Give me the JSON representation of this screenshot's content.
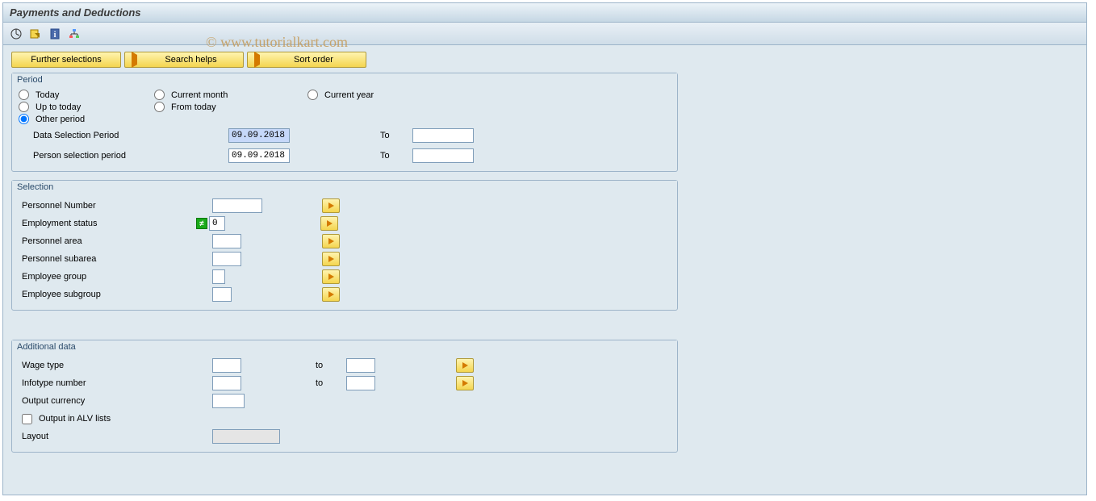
{
  "title": "Payments and Deductions",
  "watermark": "© www.tutorialkart.com",
  "toolbar_icons": [
    "execute-icon",
    "variant-icon",
    "info-icon",
    "layout-icon"
  ],
  "action_buttons": {
    "further_selections": "Further selections",
    "search_helps": "Search helps",
    "sort_order": "Sort order"
  },
  "period": {
    "group_title": "Period",
    "options": {
      "today": "Today",
      "current_month": "Current month",
      "current_year": "Current year",
      "up_to_today": "Up to today",
      "from_today": "From today",
      "other_period": "Other period"
    },
    "selected": "other_period",
    "data_selection_label": "Data Selection Period",
    "data_selection_from": "09.09.2018",
    "data_selection_to_label": "To",
    "data_selection_to": "",
    "person_selection_label": "Person selection period",
    "person_selection_from": "09.09.2018",
    "person_selection_to_label": "To",
    "person_selection_to": ""
  },
  "selection": {
    "group_title": "Selection",
    "personnel_number": {
      "label": "Personnel Number",
      "value": ""
    },
    "employment_status": {
      "label": "Employment status",
      "value": "0"
    },
    "personnel_area": {
      "label": "Personnel area",
      "value": ""
    },
    "personnel_subarea": {
      "label": "Personnel subarea",
      "value": ""
    },
    "employee_group": {
      "label": "Employee group",
      "value": ""
    },
    "employee_subgroup": {
      "label": "Employee subgroup",
      "value": ""
    }
  },
  "additional": {
    "group_title": "Additional data",
    "wage_type": {
      "label": "Wage type",
      "from": "",
      "to_label": "to",
      "to": ""
    },
    "infotype_number": {
      "label": "Infotype number",
      "from": "",
      "to_label": "to",
      "to": ""
    },
    "output_currency": {
      "label": "Output currency",
      "value": ""
    },
    "output_alv": {
      "label": "Output in ALV lists",
      "checked": false
    },
    "layout": {
      "label": "Layout",
      "value": ""
    }
  }
}
